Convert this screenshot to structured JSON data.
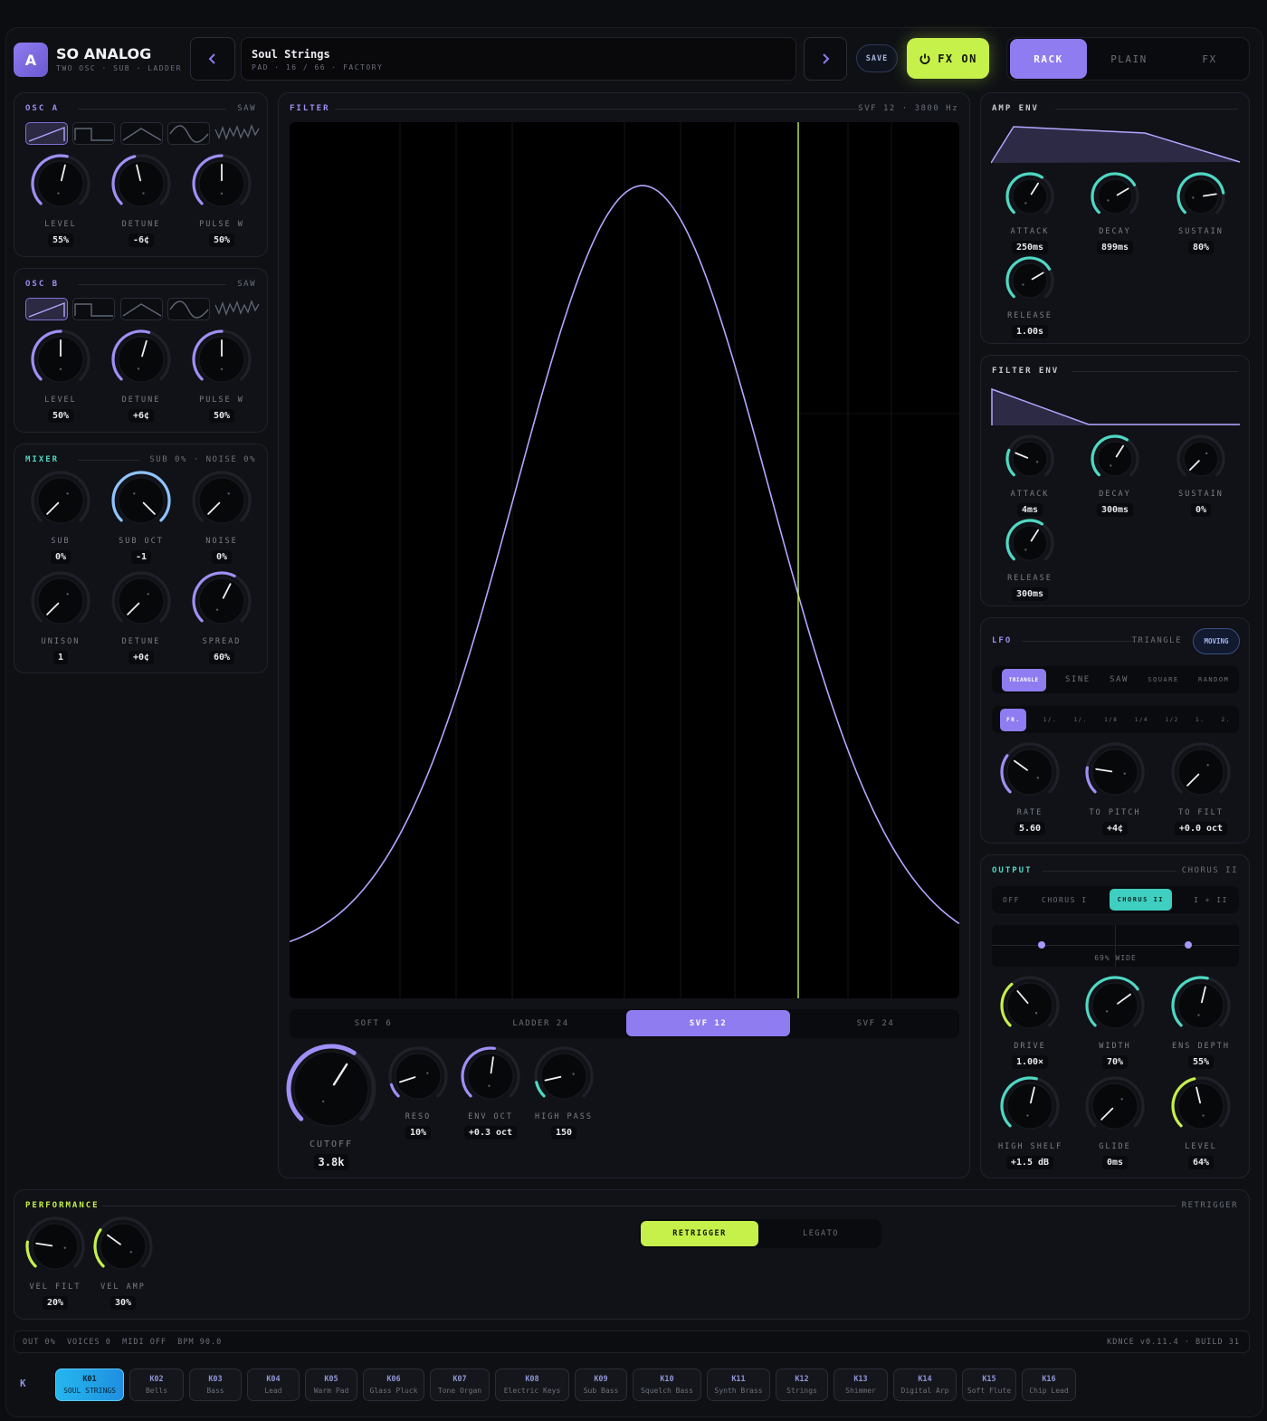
{
  "header": {
    "logo_letter": "A",
    "app_name": "SO ANALOG",
    "app_sub": "TWO OSC · SUB · LADDER",
    "preset_name": "Soul Strings",
    "preset_info": "PAD · 16 / 66 · FACTORY",
    "save": "SAVE",
    "fx_on": "FX ON",
    "views": [
      "RACK",
      "PLAIN",
      "FX"
    ]
  },
  "osc_a": {
    "title": "OSC A",
    "wave": "SAW",
    "knobs": [
      {
        "label": "LEVEL",
        "value": "55%",
        "level": 0.55
      },
      {
        "label": "DETUNE",
        "value": "-6¢",
        "level": 0.45
      },
      {
        "label": "PULSE W",
        "value": "50%",
        "level": 0.5
      }
    ]
  },
  "osc_b": {
    "title": "OSC B",
    "wave": "SAW",
    "knobs": [
      {
        "label": "LEVEL",
        "value": "50%",
        "level": 0.5
      },
      {
        "label": "DETUNE",
        "value": "+6¢",
        "level": 0.56
      },
      {
        "label": "PULSE W",
        "value": "50%",
        "level": 0.5
      }
    ]
  },
  "mixer": {
    "title": "MIXER",
    "tag": "SUB 0% · NOISE 0%",
    "knobs": [
      {
        "label": "SUB",
        "value": "0%",
        "level": 0
      },
      {
        "label": "SUB OCT",
        "value": "-1",
        "level": 1
      },
      {
        "label": "NOISE",
        "value": "0%",
        "level": 0
      },
      {
        "label": "UNISON",
        "value": "1",
        "level": 0
      },
      {
        "label": "DETUNE",
        "value": "+0¢",
        "level": 0
      },
      {
        "label": "SPREAD",
        "value": "60%",
        "level": 0.6
      }
    ]
  },
  "filter": {
    "title": "FILTER",
    "tag": "SVF 12 · 3800 Hz",
    "modes": [
      "SOFT 6",
      "LADDER 24",
      "SVF 12",
      "SVF 24"
    ],
    "active_mode": 2,
    "cutoff": {
      "label": "CUTOFF",
      "value": "3.8k",
      "level": 0.62
    },
    "knobs": [
      {
        "label": "RESO",
        "value": "10%",
        "level": 0.1
      },
      {
        "label": "ENV OCT",
        "value": "+0.3 oct",
        "level": 0.53
      },
      {
        "label": "HIGH PASS",
        "value": "150",
        "level": 0.12
      }
    ]
  },
  "amp_env": {
    "title": "AMP ENV",
    "knobs": [
      {
        "label": "ATTACK",
        "value": "250ms",
        "level": 0.62
      },
      {
        "label": "DECAY",
        "value": "899ms",
        "level": 0.72
      },
      {
        "label": "SUSTAIN",
        "value": "80%",
        "level": 0.8
      },
      {
        "label": "RELEASE",
        "value": "1.00s",
        "level": 0.72
      }
    ]
  },
  "filter_env": {
    "title": "FILTER ENV",
    "knobs": [
      {
        "label": "ATTACK",
        "value": "4ms",
        "level": 0.25
      },
      {
        "label": "DECAY",
        "value": "300ms",
        "level": 0.62
      },
      {
        "label": "SUSTAIN",
        "value": "0%",
        "level": 0
      },
      {
        "label": "RELEASE",
        "value": "300ms",
        "level": 0.62
      }
    ]
  },
  "lfo": {
    "title": "LFO",
    "tag": "TRIANGLE",
    "badge": "MOVING",
    "shapes": [
      "TRIANGLE",
      "SINE",
      "SAW",
      "SQUARE",
      "RANDOM"
    ],
    "rates": [
      "FR.",
      "1/.",
      "1/.",
      "1/8",
      "1/4",
      "1/2",
      "1.",
      "2."
    ],
    "knobs": [
      {
        "label": "RATE",
        "value": "5.60",
        "level": 0.3
      },
      {
        "label": "TO PITCH",
        "value": "+4¢",
        "level": 0.2
      },
      {
        "label": "TO FILT",
        "value": "+0.0 oct",
        "level": 0
      }
    ]
  },
  "output": {
    "title": "OUTPUT",
    "tag": "CHORUS II",
    "modes": [
      "OFF",
      "CHORUS I",
      "CHORUS II",
      "I + II"
    ],
    "width_label": "69% WIDE",
    "knobs": [
      {
        "label": "DRIVE",
        "value": "1.00×",
        "level": 0.35
      },
      {
        "label": "WIDTH",
        "value": "70%",
        "level": 0.7
      },
      {
        "label": "ENS DEPTH",
        "value": "55%",
        "level": 0.55
      },
      {
        "label": "HIGH SHELF",
        "value": "+1.5 dB",
        "level": 0.55
      },
      {
        "label": "GLIDE",
        "value": "0ms",
        "level": 0
      },
      {
        "label": "LEVEL",
        "value": "64%",
        "level": 0.45
      }
    ]
  },
  "performance": {
    "title": "PERFORMANCE",
    "tag": "RETRIGGER",
    "modes": [
      "RETRIGGER",
      "LEGATO"
    ],
    "knobs": [
      {
        "label": "VEL FILT",
        "value": "20%",
        "level": 0.2
      },
      {
        "label": "VEL AMP",
        "value": "30%",
        "level": 0.3
      }
    ]
  },
  "status": {
    "left": "OUT 0%  VOICES 0  MIDI OFF  BPM 90.0",
    "right": "KDNCE v0.11.4 · BUILD 31"
  },
  "keys_label": "K",
  "keys": [
    {
      "code": "K01",
      "name": "SOUL STRINGS"
    },
    {
      "code": "K02",
      "name": "Bells"
    },
    {
      "code": "K03",
      "name": "Bass"
    },
    {
      "code": "K04",
      "name": "Lead"
    },
    {
      "code": "K05",
      "name": "Warm Pad"
    },
    {
      "code": "K06",
      "name": "Glass Pluck"
    },
    {
      "code": "K07",
      "name": "Tone Organ"
    },
    {
      "code": "K08",
      "name": "Electric Keys"
    },
    {
      "code": "K09",
      "name": "Sub Bass"
    },
    {
      "code": "K10",
      "name": "Squelch Bass"
    },
    {
      "code": "K11",
      "name": "Synth Brass"
    },
    {
      "code": "K12",
      "name": "Strings"
    },
    {
      "code": "K13",
      "name": "Shimmer"
    },
    {
      "code": "K14",
      "name": "Digital Arp"
    },
    {
      "code": "K15",
      "name": "Soft Flute"
    },
    {
      "code": "K16",
      "name": "Chip Lead"
    }
  ],
  "colors": {
    "accent": "#8f7cf0",
    "lime": "#c6f04a",
    "teal": "#4fd8c4",
    "bg": "#0e1014"
  }
}
